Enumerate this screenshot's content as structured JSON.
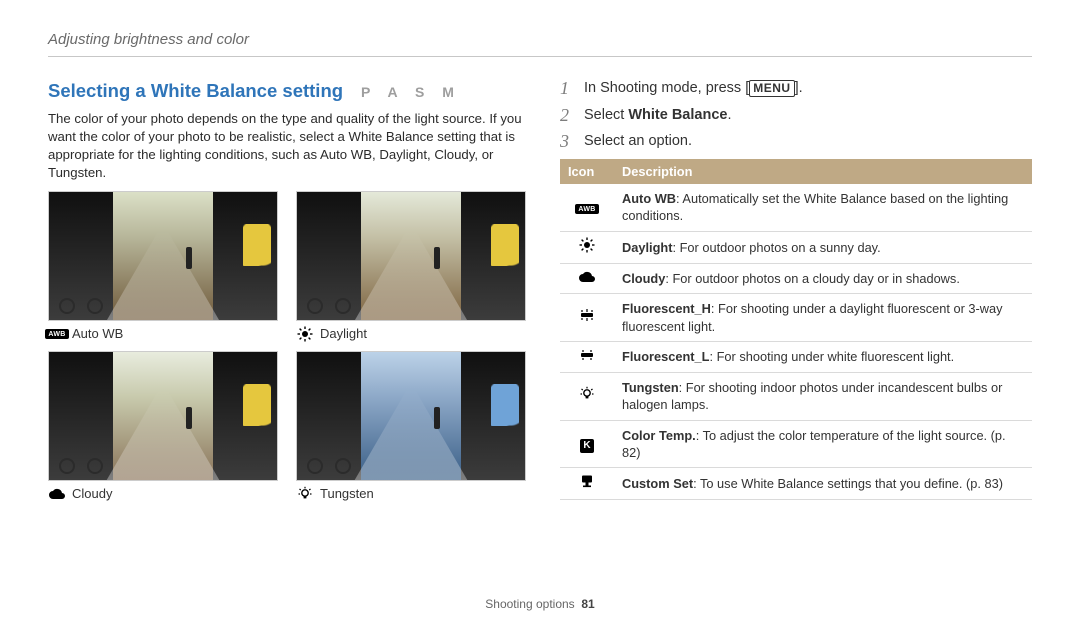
{
  "breadcrumb": "Adjusting brightness and color",
  "heading": "Selecting a White Balance setting",
  "modes": "P A S M",
  "intro": "The color of your photo depends on the type and quality of the light source. If you want the color of your photo to be realistic, select a White Balance setting that is appropriate for the lighting conditions, such as Auto WB, Daylight, Cloudy, or Tungsten.",
  "thumbs": {
    "0": {
      "label": "Auto WB",
      "icon": "auto-wb-icon"
    },
    "1": {
      "label": "Daylight",
      "icon": "daylight-icon"
    },
    "2": {
      "label": "Cloudy",
      "icon": "cloudy-icon"
    },
    "3": {
      "label": "Tungsten",
      "icon": "tungsten-icon"
    }
  },
  "steps": {
    "0": {
      "num": "1",
      "pre": "In Shooting mode, press [",
      "btn": "MENU",
      "post": "]."
    },
    "1": {
      "num": "2",
      "pre": "Select ",
      "bold": "White Balance",
      "post": "."
    },
    "2": {
      "num": "3",
      "pre": "Select an option."
    }
  },
  "table": {
    "head_icon": "Icon",
    "head_desc": "Description",
    "rows": {
      "0": {
        "icon": "auto-wb-icon",
        "bold": "Auto WB",
        "rest": ": Automatically set the White Balance based on the lighting conditions."
      },
      "1": {
        "icon": "daylight-icon",
        "bold": "Daylight",
        "rest": ": For outdoor photos on a sunny day."
      },
      "2": {
        "icon": "cloudy-icon",
        "bold": "Cloudy",
        "rest": ": For outdoor photos on a cloudy day or in shadows."
      },
      "3": {
        "icon": "fluorescent-h-icon",
        "bold": "Fluorescent_H",
        "rest": ": For shooting under a daylight fluorescent or 3-way fluorescent light."
      },
      "4": {
        "icon": "fluorescent-l-icon",
        "bold": "Fluorescent_L",
        "rest": ": For shooting under white fluorescent light."
      },
      "5": {
        "icon": "tungsten-icon",
        "bold": "Tungsten",
        "rest": ": For shooting indoor photos under incandescent bulbs or halogen lamps."
      },
      "6": {
        "icon": "color-temp-icon",
        "bold": "Color Temp.",
        "rest": ": To adjust the color temperature of the light source. (p. 82)"
      },
      "7": {
        "icon": "custom-set-icon",
        "bold": "Custom Set",
        "rest": ": To use White Balance settings that you define. (p. 83)"
      }
    }
  },
  "footer": {
    "section": "Shooting options",
    "page": "81"
  }
}
